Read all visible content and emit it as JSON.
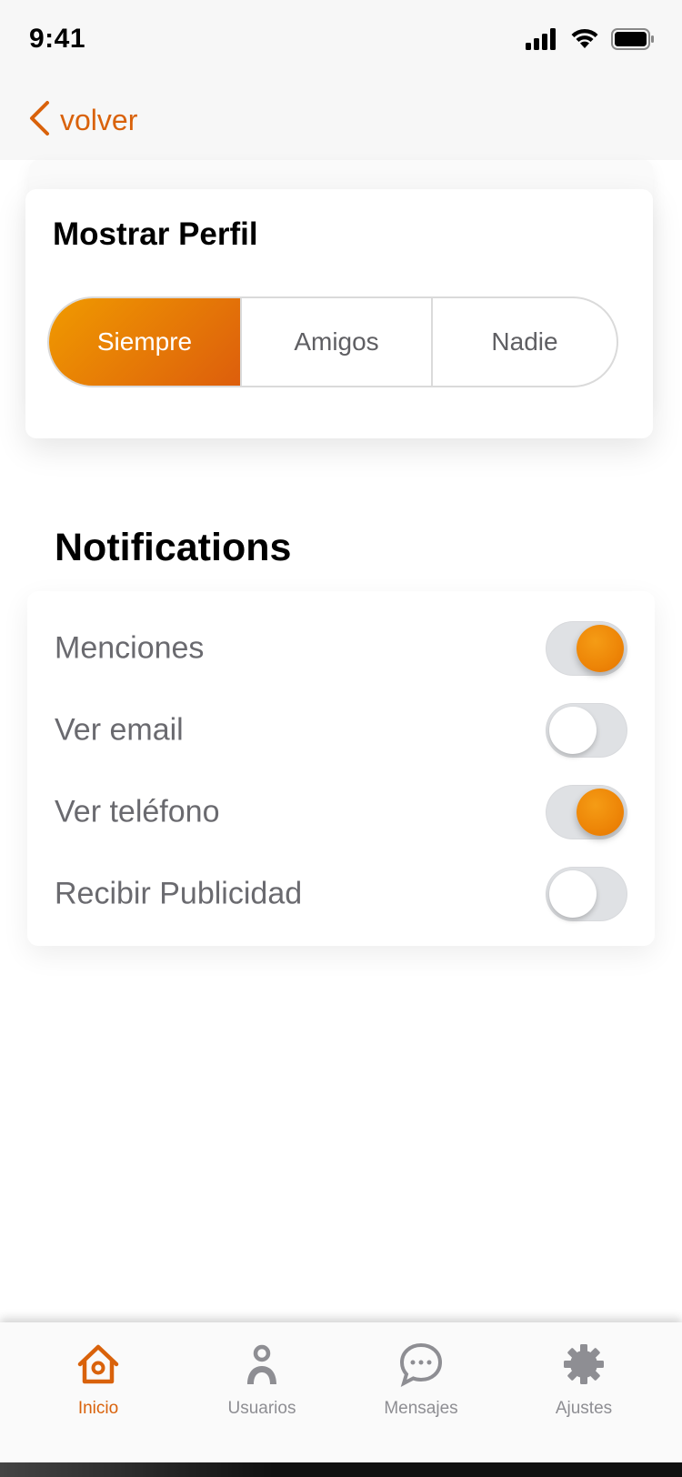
{
  "status_bar": {
    "time": "9:41",
    "icons": [
      "signal-icon",
      "wifi-icon",
      "battery-icon"
    ]
  },
  "nav": {
    "back_label": "volver",
    "back_icon": "chevron-left-icon"
  },
  "profile_card": {
    "title": "Mostrar Perfil",
    "segments": [
      {
        "label": "Siempre",
        "selected": true
      },
      {
        "label": "Amigos",
        "selected": false
      },
      {
        "label": "Nadie",
        "selected": false
      }
    ]
  },
  "notifications": {
    "title": "Notifications",
    "items": [
      {
        "label": "Menciones",
        "on": true
      },
      {
        "label": "Ver email",
        "on": false
      },
      {
        "label": "Ver teléfono",
        "on": true
      },
      {
        "label": "Recibir Publicidad",
        "on": false
      }
    ]
  },
  "tab_bar": {
    "tabs": [
      {
        "label": "Inicio",
        "icon": "home-icon",
        "active": true
      },
      {
        "label": "Usuarios",
        "icon": "user-icon",
        "active": false
      },
      {
        "label": "Mensajes",
        "icon": "chat-bubble-icon",
        "active": false
      },
      {
        "label": "Ajustes",
        "icon": "gear-icon",
        "active": false
      }
    ]
  },
  "colors": {
    "accent": "#d9620b",
    "accent_gradient_start": "#f09a00",
    "accent_gradient_end": "#dd5e0c",
    "inactive_tab": "#8e8e93"
  }
}
